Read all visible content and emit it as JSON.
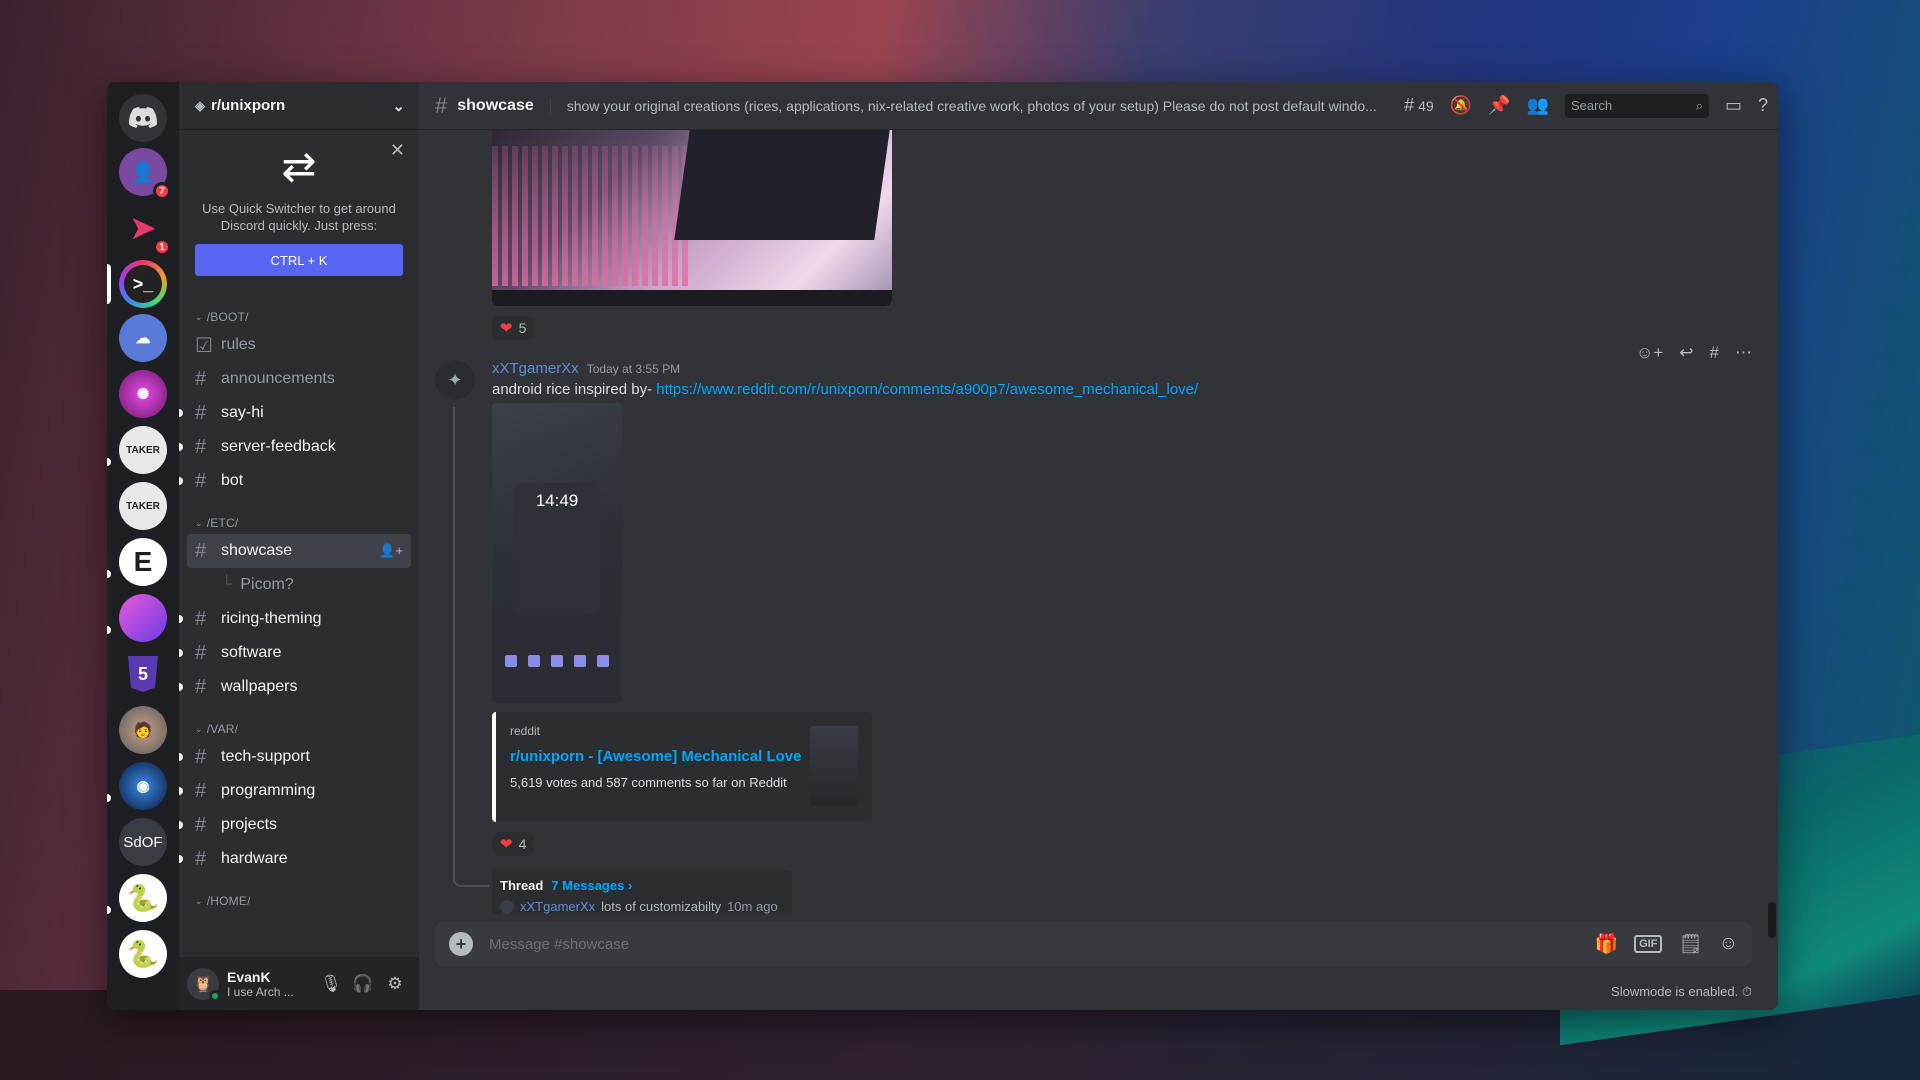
{
  "server_rail": {
    "servers": [
      {
        "name": "discord-home",
        "badge": "",
        "color": "#313338"
      },
      {
        "name": "friends",
        "badge": "7",
        "color": "#5a3a8a"
      },
      {
        "name": "server-red",
        "badge": "1",
        "color": "#1e1f22"
      },
      {
        "name": "unixporn",
        "badge": "",
        "color": "#2a2a2a"
      },
      {
        "name": "server-blue",
        "badge": "",
        "color": "#5865f2"
      },
      {
        "name": "server-purple",
        "badge": "",
        "color": "#6b1a6b"
      },
      {
        "name": "taker-1",
        "badge": "",
        "color": "#e8e8e8"
      },
      {
        "name": "taker-2",
        "badge": "",
        "color": "#e8e8e8"
      },
      {
        "name": "server-e",
        "badge": "",
        "color": "#ffffff"
      },
      {
        "name": "server-apple",
        "badge": "",
        "color": "#9a3ab0"
      },
      {
        "name": "server-html5",
        "badge": "",
        "color": "#1e1f22"
      },
      {
        "name": "server-person",
        "badge": "",
        "color": "#7a7a7a"
      },
      {
        "name": "server-space",
        "badge": "",
        "color": "#1a3a6a"
      },
      {
        "name": "server-sdof",
        "badge": "",
        "color": "#3a3c43"
      },
      {
        "name": "server-cobra",
        "badge": "",
        "color": "#ffffff"
      },
      {
        "name": "server-cobra-2",
        "badge": "",
        "color": "#ffffff"
      }
    ],
    "sdof_label": "SdOF",
    "taker_label": "TAKER",
    "html5_label": "5",
    "e_label": "E"
  },
  "sidebar": {
    "guild_name": "r/unixporn",
    "quick_switcher": {
      "text": "Use Quick Switcher to get around Discord quickly. Just press:",
      "button": "CTRL + K"
    },
    "categories": [
      {
        "name": "/BOOT/",
        "channels": [
          {
            "label": "rules",
            "state": "muted"
          },
          {
            "label": "announcements",
            "state": "muted"
          },
          {
            "label": "say-hi",
            "state": "unread"
          },
          {
            "label": "server-feedback",
            "state": "unread"
          },
          {
            "label": "bot",
            "state": "unread"
          }
        ]
      },
      {
        "name": "/ETC/",
        "channels": [
          {
            "label": "showcase",
            "state": "active"
          },
          {
            "label": "ricing-theming",
            "state": "unread"
          },
          {
            "label": "software",
            "state": "unread"
          },
          {
            "label": "wallpapers",
            "state": "unread"
          }
        ],
        "thread": "Picom?"
      },
      {
        "name": "/VAR/",
        "channels": [
          {
            "label": "tech-support",
            "state": "unread"
          },
          {
            "label": "programming",
            "state": "unread"
          },
          {
            "label": "projects",
            "state": "unread"
          },
          {
            "label": "hardware",
            "state": "unread"
          }
        ]
      },
      {
        "name": "/HOME/",
        "channels": []
      }
    ],
    "user": {
      "name": "EvanK",
      "status": "I use Arch ..."
    }
  },
  "header": {
    "channel": "showcase",
    "topic": "show your original creations (rices, applications, nix-related creative work, photos of your setup) Please do not post default windo...",
    "threads_count": "49",
    "search_placeholder": "Search"
  },
  "messages": {
    "prev_reaction_count": "5",
    "author": "xXTgamerXx",
    "timestamp": "Today at 3:55 PM",
    "text_prefix": "android rice inspired by- ",
    "link": "https://www.reddit.com/r/unixporn/comments/a900p7/awesome_mechanical_love/",
    "phone_clock": "14:49",
    "embed": {
      "provider": "reddit",
      "title": "r/unixporn - [Awesome] Mechanical Love",
      "description": "5,619 votes and 587 comments so far on Reddit"
    },
    "reaction_count": "4",
    "thread": {
      "label": "Thread",
      "count": "7 Messages ›",
      "last_user": "xXTgamerXx",
      "last_text": "lots of customizabilty",
      "last_time": "10m ago"
    }
  },
  "composer": {
    "placeholder": "Message #showcase",
    "gif_label": "GIF",
    "slowmode": "Slowmode is enabled."
  },
  "colors": {
    "accent": "#5865f2",
    "link": "#00a8fc",
    "reaction_heart": "#f23f43"
  }
}
